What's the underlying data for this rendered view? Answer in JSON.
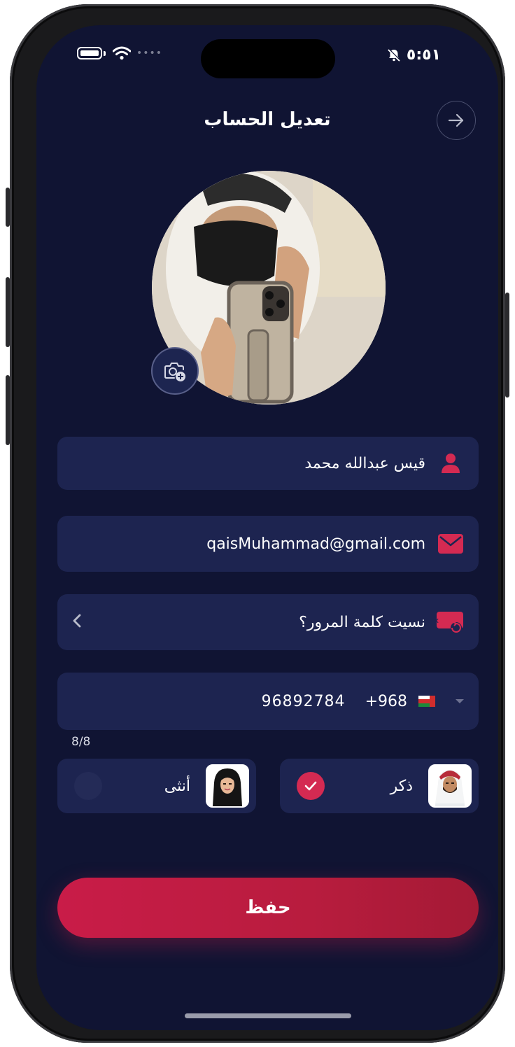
{
  "status_bar": {
    "time": "٥:٥١"
  },
  "header": {
    "title": "تعديل الحساب"
  },
  "form": {
    "name": "قيس عبدالله محمد",
    "email": "qaisMuhammad@gmail.com",
    "forgot_password": "نسيت كلمة المرور؟",
    "country_code": "+968",
    "phone": "96892784",
    "phone_counter": "8/8"
  },
  "gender": {
    "male_label": "ذكر",
    "female_label": "أنثى",
    "selected": "male"
  },
  "actions": {
    "save_label": "حفظ"
  },
  "colors": {
    "background": "#101433",
    "field": "#1d2450",
    "accent": "#c91c48"
  },
  "icons": [
    "battery-icon",
    "wifi-icon",
    "bell-off-icon",
    "arrow-right-icon",
    "camera-add-icon",
    "user-icon",
    "mail-icon",
    "password-reset-icon",
    "chevron-left-icon",
    "oman-flag-icon",
    "caret-down-icon",
    "check-icon"
  ]
}
